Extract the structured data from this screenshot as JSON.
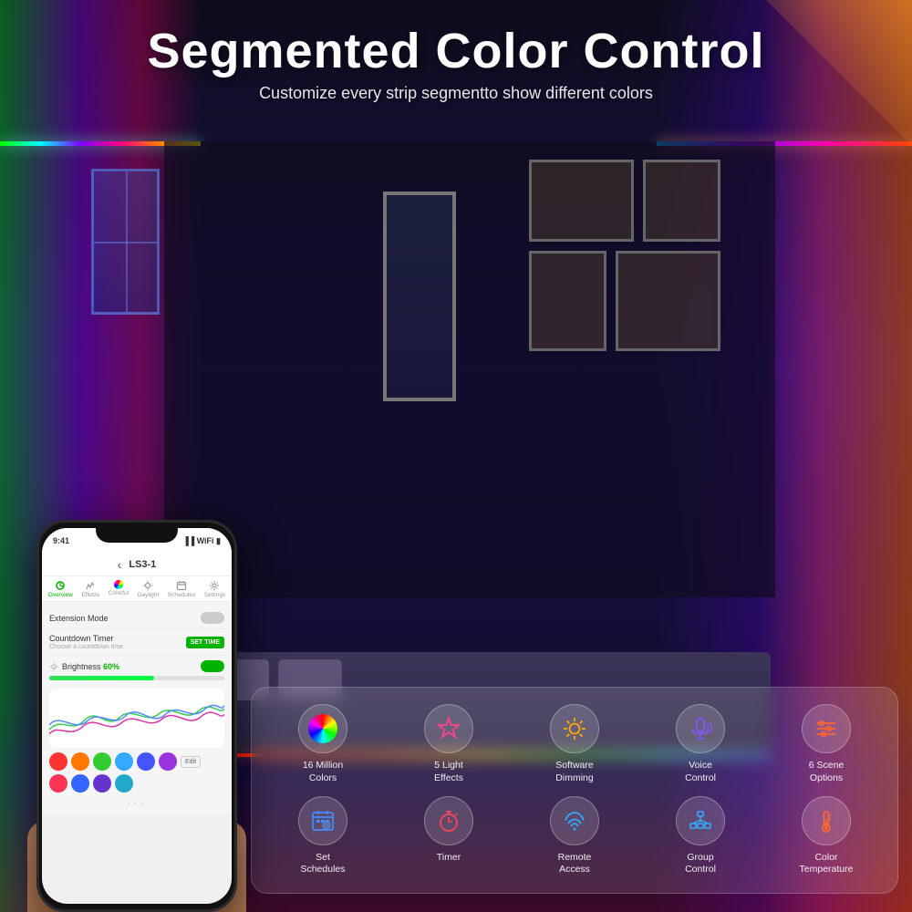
{
  "header": {
    "title": "Segmented Color Control",
    "subtitle": "Customize every strip segmentto show different colors"
  },
  "phone": {
    "status_time": "9:41",
    "device_name": "LS3-1",
    "nav_items": [
      {
        "label": "Overview",
        "active": true
      },
      {
        "label": "Effects"
      },
      {
        "label": "Colorful"
      },
      {
        "label": "Daylight"
      },
      {
        "label": "Schedules"
      },
      {
        "label": "Settings"
      }
    ],
    "extension_mode_label": "Extension Mode",
    "countdown_label": "Countdown Timer",
    "countdown_btn": "SET TIME",
    "countdown_sub": "Choose a countdown time.",
    "brightness_label": "Brightness",
    "brightness_pct": "60%"
  },
  "features": {
    "row1": [
      {
        "id": "colors-16m",
        "icon": "🎨",
        "label": "16 Million\nColors",
        "type": "wheel"
      },
      {
        "id": "light-effects",
        "icon": "⭐",
        "label": "5 Light\nEffects",
        "type": "star"
      },
      {
        "id": "software-dimming",
        "icon": "☀",
        "label": "Software\nDimming",
        "type": "sun"
      },
      {
        "id": "voice-control",
        "icon": "🎤",
        "label": "Voice\nControl",
        "type": "mic"
      },
      {
        "id": "scene-options",
        "icon": "🎛",
        "label": "6 Scene\nOptions",
        "type": "sliders"
      }
    ],
    "row2": [
      {
        "id": "set-schedules",
        "icon": "📅",
        "label": "Set\nSchedules",
        "type": "calendar"
      },
      {
        "id": "timer",
        "icon": "⏱",
        "label": "Timer",
        "type": "timer"
      },
      {
        "id": "remote-access",
        "icon": "📡",
        "label": "Remote\nAccess",
        "type": "remote"
      },
      {
        "id": "group-control",
        "icon": "🔗",
        "label": "Group\nControl",
        "type": "network"
      },
      {
        "id": "color-temp",
        "icon": "🌡",
        "label": "Color\nTemperature",
        "type": "thermometer"
      }
    ]
  },
  "colors": {
    "accent_green": "#00b300",
    "accent_magenta": "#e0007a",
    "panel_bg": "rgba(255,255,255,0.12)"
  }
}
